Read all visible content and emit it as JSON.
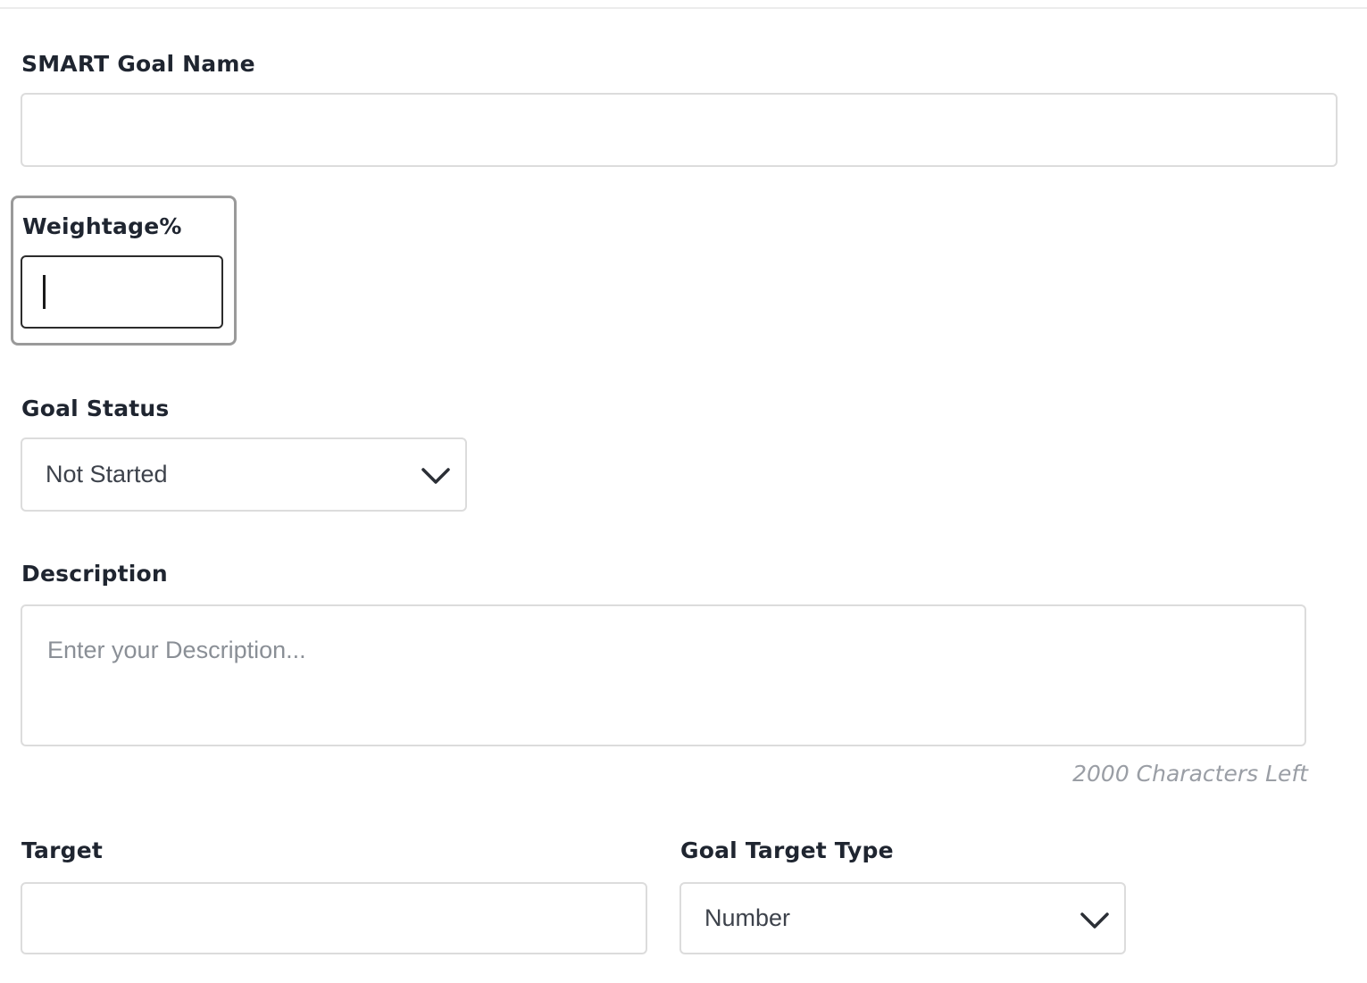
{
  "form": {
    "goal_name": {
      "label": "SMART Goal Name",
      "value": ""
    },
    "weightage": {
      "label": "Weightage%",
      "value": ""
    },
    "goal_status": {
      "label": "Goal Status",
      "value": "Not Started"
    },
    "description": {
      "label": "Description",
      "value": "",
      "placeholder": "Enter your Description...",
      "counter": "2000 Characters Left"
    },
    "target": {
      "label": "Target",
      "value": ""
    },
    "goal_target_type": {
      "label": "Goal Target Type",
      "value": "Number"
    }
  },
  "icons": {
    "dropdown": "chevron-down-icon"
  },
  "colors": {
    "border": "#dcdcdc",
    "focus_border": "#2c2c2c",
    "label_text": "#1f2530",
    "muted_text": "#9a9ea5"
  }
}
